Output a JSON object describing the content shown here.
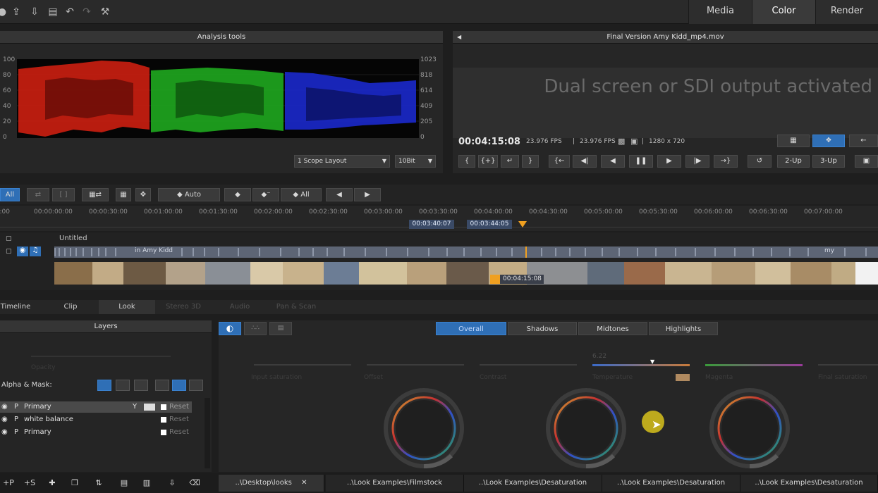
{
  "modes": [
    {
      "label": "Media",
      "active": false
    },
    {
      "label": "Color",
      "active": true
    },
    {
      "label": "Render",
      "active": false
    }
  ],
  "analysis": {
    "title": "Analysis tools",
    "left_ticks": [
      "100",
      "80",
      "60",
      "40",
      "20",
      "0"
    ],
    "right_ticks": [
      "1023",
      "818",
      "614",
      "409",
      "205",
      "0"
    ],
    "layout_dropdown": "1 Scope Layout",
    "bit_dropdown": "10Bit"
  },
  "viewer": {
    "title": "Final Version Amy Kidd_mp4.mov",
    "message": "Dual screen or SDI output activated",
    "timecode": "00:04:15:08",
    "fps1": "23.976 FPS",
    "fps2": "23.976 FPS",
    "resolution": "1280 x 720",
    "btn_2up": "2-Up",
    "btn_3up": "3-Up"
  },
  "timeline": {
    "all_label": "All",
    "auto_label": "Auto",
    "all2_label": "All",
    "ruler": [
      "00:00:00:00",
      "00:00:30:00",
      "00:01:00:00",
      "00:01:30:00",
      "00:02:00:00",
      "00:02:30:00",
      "00:03:00:00",
      "00:03:30:00",
      "00:04:00:00",
      "00:04:30:00",
      "00:05:00:00",
      "00:05:30:00",
      "00:06:00:00",
      "00:06:30:00",
      "00:07:00:00"
    ],
    "in_marker": "00:03:40:07",
    "out_marker": "00:03:44:05",
    "track_name": "Untitled",
    "clip_label": "in Amy Kidd",
    "clip_label2": "my",
    "playhead_tc": "00:04:15:08"
  },
  "panel_tabs": [
    {
      "label": "Timeline",
      "active": false
    },
    {
      "label": "Clip",
      "active": false
    },
    {
      "label": "Look",
      "active": true
    },
    {
      "label": "Stereo 3D",
      "active": false
    },
    {
      "label": "Audio",
      "active": false
    },
    {
      "label": "Pan & Scan",
      "active": false
    }
  ],
  "layers": {
    "title": "Layers",
    "opacity_label": "Opacity",
    "alpha_label": "Alpha & Mask:",
    "items": [
      {
        "prefix": "P",
        "name": "Primary",
        "reset": "Reset",
        "selected": true
      },
      {
        "prefix": "P",
        "name": "white balance",
        "reset": "Reset",
        "selected": false
      },
      {
        "prefix": "P",
        "name": "Primary",
        "reset": "Reset",
        "selected": false
      }
    ]
  },
  "look": {
    "ranges": [
      {
        "label": "Overall",
        "active": true
      },
      {
        "label": "Shadows",
        "active": false
      },
      {
        "label": "Midtones",
        "active": false
      },
      {
        "label": "Highlights",
        "active": false
      }
    ],
    "sliders": [
      "Input saturation",
      "Offset",
      "Contrast",
      "Temperature",
      "Magenta",
      "Final saturation"
    ],
    "temperature_value": "6.22"
  },
  "bottom": {
    "add_p": "+P",
    "add_s": "+S",
    "looks": [
      {
        "label": "..\\Desktop\\looks",
        "active": true
      },
      {
        "label": "..\\Look Examples\\Filmstock",
        "active": false
      },
      {
        "label": "..\\Look Examples\\Desaturation",
        "active": false
      },
      {
        "label": "..\\Look Examples\\Desaturation",
        "active": false
      },
      {
        "label": "..\\Look Examples\\Desaturation",
        "active": false
      }
    ]
  },
  "colors": {
    "accent": "#2f6fb6",
    "scope_red": "#d02010",
    "scope_green": "#20b020",
    "scope_blue": "#1a2ad0",
    "playhead": "#f0a020"
  }
}
